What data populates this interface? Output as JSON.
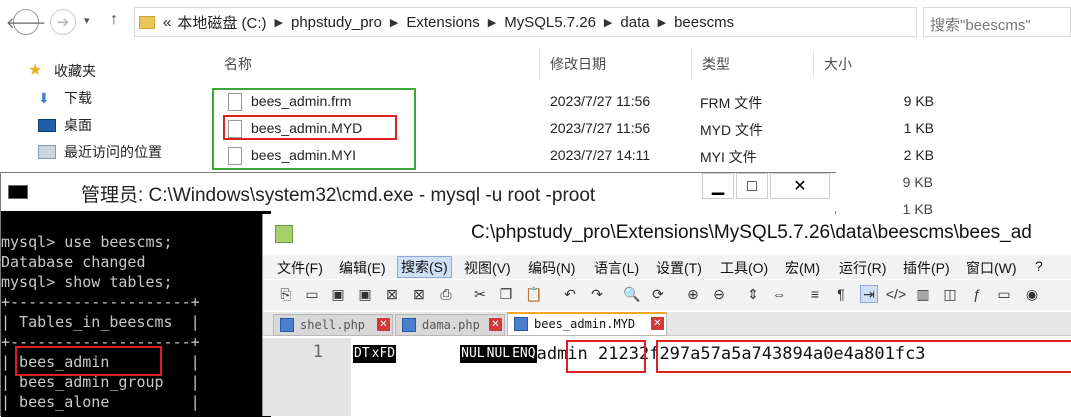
{
  "explorer": {
    "address": [
      "本地磁盘 (C:)",
      "phpstudy_pro",
      "Extensions",
      "MySQL5.7.26",
      "data",
      "beescms"
    ],
    "address_prefix": "«",
    "search_placeholder": "搜索\"beescms\"",
    "sidebar": [
      "收藏夹",
      "下载",
      "桌面",
      "最近访问的位置"
    ],
    "columns": [
      "名称",
      "修改日期",
      "类型",
      "大小"
    ],
    "files": [
      {
        "name": "bees_admin.frm",
        "date": "2023/7/27 11:56",
        "type": "FRM 文件",
        "size": "9 KB"
      },
      {
        "name": "bees_admin.MYD",
        "date": "2023/7/27 11:56",
        "type": "MYD 文件",
        "size": "1 KB"
      },
      {
        "name": "bees_admin.MYI",
        "date": "2023/7/27 14:11",
        "type": "MYI 文件",
        "size": "2 KB"
      }
    ],
    "hidden_sizes": [
      "9 KB",
      "1 KB"
    ]
  },
  "cmd": {
    "title": "管理员: C:\\Windows\\system32\\cmd.exe - mysql  -u root -proot",
    "lines": [
      "mysql> use beescms;",
      "Database changed",
      "mysql> show tables;",
      "+--------------------+",
      "| Tables_in_beescms  |",
      "+--------------------+",
      "| bees_admin         |",
      "| bees_admin_group   |",
      "| bees_alone         |"
    ]
  },
  "npp": {
    "title": "C:\\phpstudy_pro\\Extensions\\MySQL5.7.26\\data\\beescms\\bees_ad",
    "menu": [
      "文件(F)",
      "编辑(E)",
      "搜索(S)",
      "视图(V)",
      "编码(N)",
      "语言(L)",
      "设置(T)",
      "工具(O)",
      "宏(M)",
      "运行(R)",
      "插件(P)",
      "窗口(W)",
      "?"
    ],
    "tabs": [
      "shell.php",
      "dama.php",
      "bees_admin.MYD"
    ],
    "line_number": "1",
    "ctl_tokens": [
      "DT",
      "xFD",
      "NUL",
      "NUL",
      "ENQ"
    ],
    "username": "admin",
    "hash": "21232f297a57a5a743894a0e4a801fc3"
  }
}
